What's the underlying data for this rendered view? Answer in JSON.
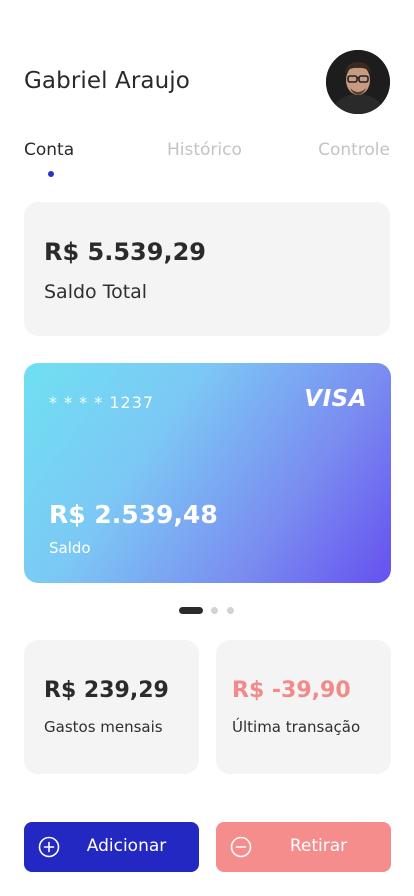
{
  "user": {
    "name": "Gabriel Araujo"
  },
  "tabs": [
    {
      "label": "Conta",
      "active": true
    },
    {
      "label": "Histórico",
      "active": false
    },
    {
      "label": "Controle",
      "active": false
    }
  ],
  "total": {
    "amount": "R$ 5.539,29",
    "label": "Saldo Total"
  },
  "card": {
    "number": "* * * * 1237",
    "brand": "VISA",
    "balance": "R$ 2.539,48",
    "balance_label": "Saldo"
  },
  "pager": {
    "pages": 3,
    "current": 1
  },
  "stats": {
    "monthly": {
      "amount": "R$ 239,29",
      "label": "Gastos mensais"
    },
    "last": {
      "amount": "R$ -39,90",
      "label": "Última transação"
    }
  },
  "actions": {
    "add_label": "Adicionar",
    "withdraw_label": "Retirar"
  },
  "colors": {
    "primary": "#2328c3",
    "danger": "#f58d8d",
    "card_bg": "#f4f4f4",
    "tab_indicator": "#2b33c6"
  },
  "icons": {
    "add": "plus-circle-icon",
    "withdraw": "minus-circle-icon"
  }
}
